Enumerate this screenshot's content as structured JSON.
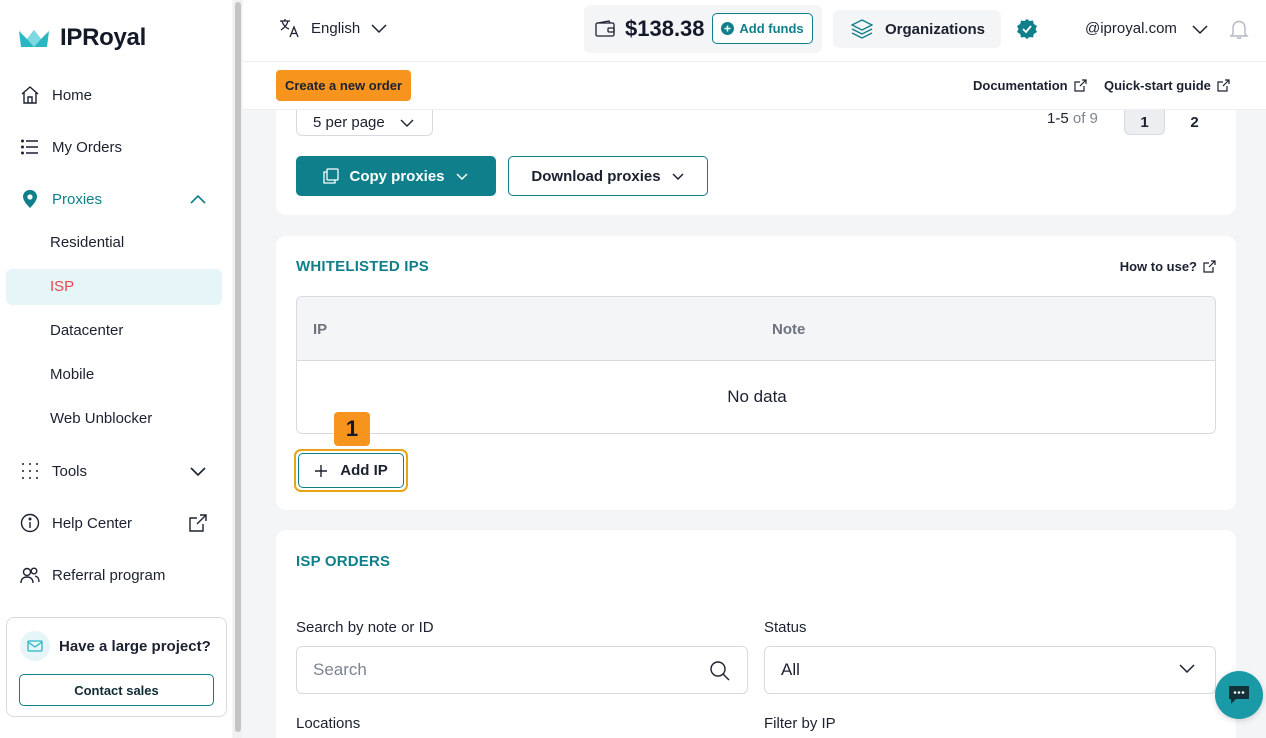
{
  "brand": {
    "name": "IPRoyal"
  },
  "sidebar": {
    "items": [
      {
        "label": "Home"
      },
      {
        "label": "My Orders"
      },
      {
        "label": "Proxies"
      },
      {
        "label": "Tools"
      },
      {
        "label": "Help Center"
      },
      {
        "label": "Referral program"
      }
    ],
    "proxies_sub": [
      {
        "label": "Residential"
      },
      {
        "label": "ISP",
        "active": true
      },
      {
        "label": "Datacenter"
      },
      {
        "label": "Mobile"
      },
      {
        "label": "Web Unblocker"
      }
    ],
    "promo": {
      "title": "Have a large project?",
      "button": "Contact sales"
    }
  },
  "topbar": {
    "language": "English",
    "balance": "$138.38",
    "add_funds": "Add funds",
    "organizations": "Organizations",
    "account": "@iproyal.com"
  },
  "subbar": {
    "create_order": "Create a new order",
    "documentation": "Documentation",
    "quick_start": "Quick-start guide"
  },
  "proxies_card": {
    "per_page": "5 per page",
    "range": "1-5",
    "of": "of 9",
    "pages": [
      "1",
      "2"
    ],
    "copy": "Copy proxies",
    "download": "Download proxies"
  },
  "whitelist": {
    "title": "WHITELISTED IPS",
    "how_to": "How to use?",
    "columns": [
      "IP",
      "Note"
    ],
    "empty": "No data",
    "add_ip": "Add IP",
    "step_badge": "1"
  },
  "isp_orders": {
    "title": "ISP ORDERS",
    "search_label": "Search by note or ID",
    "search_placeholder": "Search",
    "status_label": "Status",
    "status_value": "All",
    "locations_label": "Locations",
    "filter_ip_label": "Filter by IP"
  },
  "colors": {
    "accent": "#0f7f8b",
    "orange": "#f7941d",
    "active_bg": "#e6f5f7",
    "active_text": "#e5484d"
  }
}
